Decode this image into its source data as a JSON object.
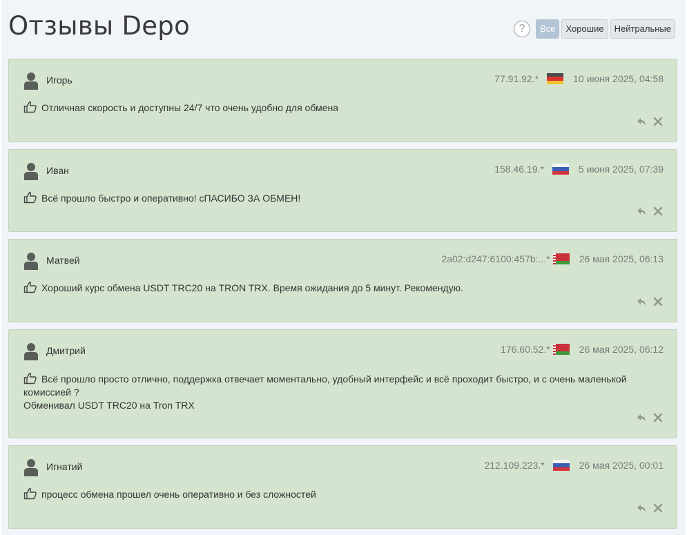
{
  "page": {
    "title": "Отзывы Depo",
    "help_label": "?",
    "filters": [
      {
        "label": "Все",
        "active": true
      },
      {
        "label": "Хорошие",
        "active": false
      },
      {
        "label": "Нейтральные",
        "active": false
      }
    ]
  },
  "reviews": [
    {
      "name": "Игорь",
      "ip": "77.91.92.*",
      "country": "germany",
      "date": "10 июня 2025, 04:58",
      "text": "Отличная скорость и доступны 24/7 что очень удобно для обмена",
      "text2": ""
    },
    {
      "name": "Иван",
      "ip": "158.46.19.*",
      "country": "russia",
      "date": "5 июня 2025, 07:39",
      "text": "Всё прошло быстро и оперативно! сПАСИБО ЗА ОБМЕН!",
      "text2": ""
    },
    {
      "name": "Матвей",
      "ip": "2a02:d247:6100:457b:...*",
      "country": "belarus",
      "date": "26 мая 2025, 06:13",
      "text": "Хороший курс обмена USDT TRC20 на TRON TRX. Время ожидания до 5 минут. Рекомендую.",
      "text2": ""
    },
    {
      "name": "Дмитрий",
      "ip": "176.60.52.*",
      "country": "belarus",
      "date": "26 мая 2025, 06:12",
      "text": "Всё прошло просто отлично, поддержка отвечает моментально, удобный интерфейс и всё проходит быстро, и с очень маленькой комиссией ?",
      "text2": "Обменивал USDT TRC20 на Tron TRX"
    },
    {
      "name": "Игнатий",
      "ip": "212.109.223.*",
      "country": "russia",
      "date": "26 мая 2025, 00:01",
      "text": "процесс обмена прошел очень оперативно и без сложностей",
      "text2": ""
    }
  ],
  "icons": {
    "avatar": "user-avatar-icon",
    "positive": "thumbs-up-icon",
    "reply": "reply-icon",
    "delete": "close-icon"
  },
  "colors": {
    "review_bg": "#d5e4cf",
    "active_filter": "#b3c4d6",
    "page_bg": "#f1f4f8"
  }
}
